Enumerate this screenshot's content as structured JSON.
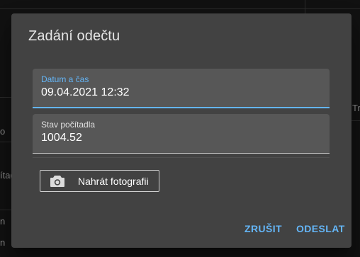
{
  "dialog": {
    "title": "Zadání odečtu",
    "datetime_field": {
      "label": "Datum a čas",
      "value": "09.04.2021 12:32"
    },
    "counter_field": {
      "label": "Stav počítadla",
      "value": "1004.52"
    },
    "upload_button": {
      "label": "Nahrát fotografii",
      "icon": "camera-icon"
    },
    "actions": {
      "cancel": "ZRUŠIT",
      "submit": "ODESLAT"
    }
  },
  "background": {
    "right_text": "Tr",
    "left_texts": [
      "o",
      "ítad",
      "n",
      "n"
    ]
  },
  "colors": {
    "accent": "#64b5f6",
    "dialog_bg": "#424242",
    "field_bg": "#575757",
    "page_bg": "#111111"
  }
}
